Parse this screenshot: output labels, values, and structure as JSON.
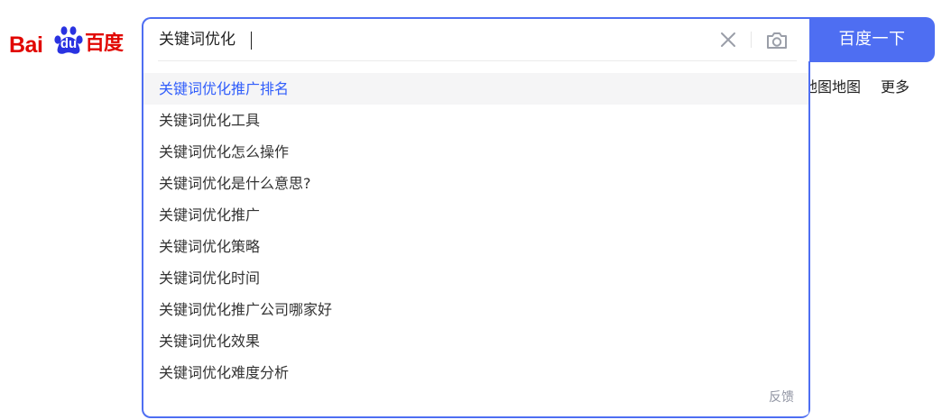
{
  "logo": {
    "left_text": "Bai",
    "paw_text": "du",
    "right_text": "百度",
    "brand_red": "#e10601",
    "brand_blue": "#2932e1"
  },
  "search": {
    "value": "关键词优化",
    "clear_icon": "close-icon",
    "camera_icon": "camera-icon",
    "accent_color": "#4e6ef2",
    "button_label": "百度一下"
  },
  "suggestions": [
    {
      "text": "关键词优化推广排名"
    },
    {
      "text": "关键词优化工具"
    },
    {
      "text": "关键词优化怎么操作"
    },
    {
      "text": "关键词优化是什么意思?"
    },
    {
      "text": "关键词优化推广"
    },
    {
      "text": "关键词优化策略"
    },
    {
      "text": "关键词优化时间"
    },
    {
      "text": "关键词优化推广公司哪家好"
    },
    {
      "text": "关键词优化效果"
    },
    {
      "text": "关键词优化难度分析"
    }
  ],
  "feedback_label": "反馈",
  "nav": {
    "map_label": "地图地图",
    "more_label": "更多"
  }
}
